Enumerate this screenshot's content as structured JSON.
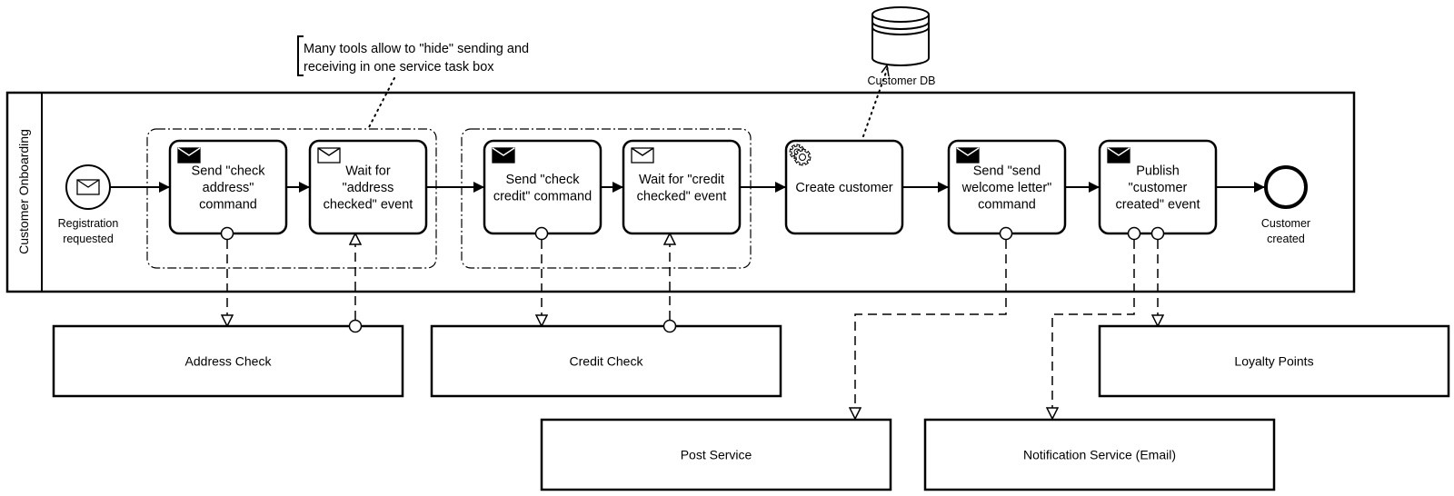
{
  "annotation": {
    "lines": [
      "Many tools allow to \"hide\" sending and",
      "receiving in one service task box"
    ]
  },
  "data_store": {
    "label": "Customer DB",
    "icon": "database-icon"
  },
  "lane": {
    "label": "Customer Onboarding"
  },
  "start_event": {
    "label_lines": [
      "Registration",
      "requested"
    ],
    "icon": "envelope-outline-icon"
  },
  "end_event": {
    "label_lines": [
      "Customer",
      "created"
    ]
  },
  "tasks": [
    {
      "id": "send-check-address",
      "lines": [
        "Send \"check",
        "address\"",
        "command"
      ],
      "icon": "envelope-filled-icon"
    },
    {
      "id": "wait-address-checked",
      "lines": [
        "Wait for",
        "\"address",
        "checked\" event"
      ],
      "icon": "envelope-outline-icon"
    },
    {
      "id": "send-check-credit",
      "lines": [
        "Send \"check",
        "credit\" command"
      ],
      "icon": "envelope-filled-icon"
    },
    {
      "id": "wait-credit-checked",
      "lines": [
        "Wait for \"credit",
        "checked\" event"
      ],
      "icon": "envelope-outline-icon"
    },
    {
      "id": "create-customer",
      "lines": [
        "Create customer"
      ],
      "icon": "gears-icon"
    },
    {
      "id": "send-welcome-letter",
      "lines": [
        "Send \"send",
        "welcome letter\"",
        "command"
      ],
      "icon": "envelope-filled-icon"
    },
    {
      "id": "publish-customer-created",
      "lines": [
        "Publish",
        "\"customer",
        "created\" event"
      ],
      "icon": "envelope-filled-icon"
    }
  ],
  "pools": [
    {
      "id": "address-check",
      "label": "Address Check"
    },
    {
      "id": "credit-check",
      "label": "Credit Check"
    },
    {
      "id": "loyalty-points",
      "label": "Loyalty Points"
    },
    {
      "id": "post-service",
      "label": "Post Service"
    },
    {
      "id": "notification-service",
      "label": "Notification Service (Email)"
    }
  ]
}
